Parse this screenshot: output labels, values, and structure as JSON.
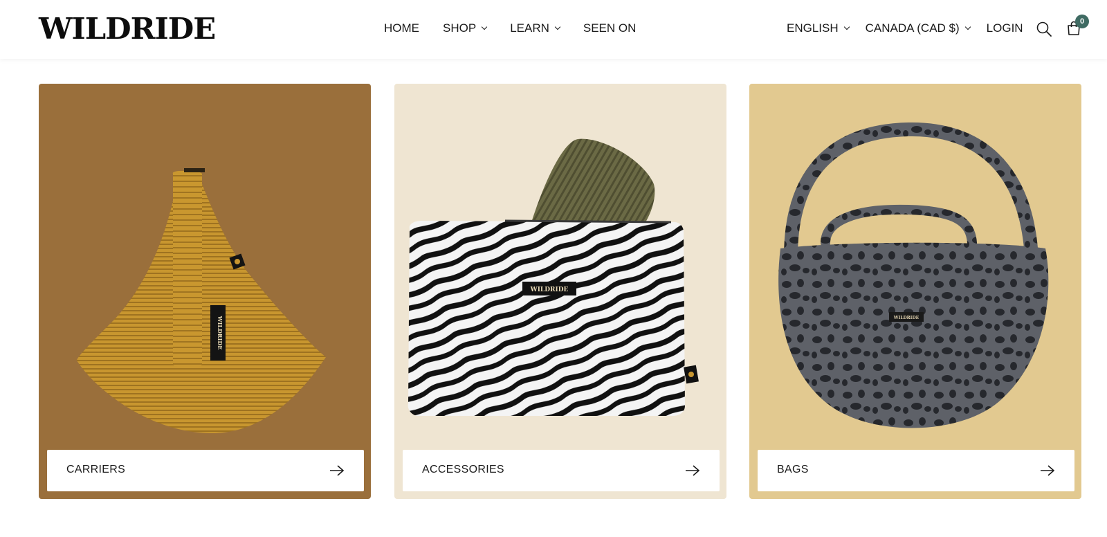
{
  "brand": {
    "logo": "WILDRIDE"
  },
  "nav": {
    "home": "HOME",
    "shop": "SHOP",
    "learn": "LEARN",
    "seen_on": "SEEN ON",
    "language": "ENGLISH",
    "currency": "CANADA (CAD $)",
    "login": "LOGIN",
    "cart_count": "0"
  },
  "icons": {
    "search": "search-icon",
    "cart": "cart-icon",
    "arrow": "arrow-right-icon",
    "chevron": "chevron-down-icon"
  },
  "collections": [
    {
      "label": "CARRIERS",
      "bg": "#9a6f3b"
    },
    {
      "label": "ACCESSORIES",
      "bg": "#efe5d2"
    },
    {
      "label": "BAGS",
      "bg": "#e2c990"
    }
  ],
  "product_tags": {
    "label_text": "WILDRIDE"
  },
  "colors": {
    "accent": "#3f6b63",
    "text": "#1a1a1a"
  }
}
